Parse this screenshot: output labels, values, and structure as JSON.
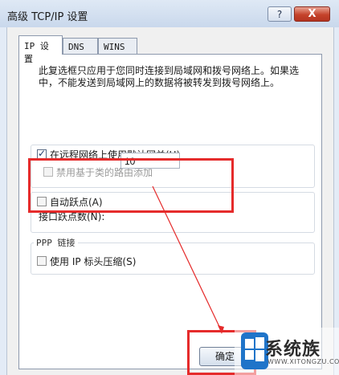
{
  "window": {
    "title": "高级 TCP/IP 设置",
    "help_label": "?",
    "close_label": "X"
  },
  "tabs": [
    {
      "label": "IP 设置",
      "active": true
    },
    {
      "label": "DNS",
      "active": false
    },
    {
      "label": "WINS",
      "active": false
    }
  ],
  "description": {
    "line1": "此复选框只应用于您同时连接到局域网和拨号网络上。如果选",
    "line2": "中，不能发送到局域网上的数据将被转发到拨号网络上。"
  },
  "gateway_group": {
    "use_default_gateway": {
      "label": "在远程网络上使用默认网关(U)",
      "checked": true
    },
    "disable_class_routes": {
      "label": "禁用基于类的路由添加",
      "checked": false,
      "enabled": false
    }
  },
  "metric_group": {
    "automatic_metric": {
      "label": "自动跃点(A)",
      "checked": false
    },
    "interface_metric_label": "接口跃点数(N):",
    "interface_metric_value": "10"
  },
  "ppp_group": {
    "legend": "PPP 链接",
    "ip_header_compression": {
      "label": "使用 IP 标头压缩(S)",
      "checked": false
    }
  },
  "footer": {
    "ok_label": "确定"
  },
  "watermark": {
    "brand": "系统族",
    "url": "WWW.XITONGZU.COM"
  },
  "colors": {
    "highlight": "#e52b2b",
    "close_button": "#c5432b"
  }
}
